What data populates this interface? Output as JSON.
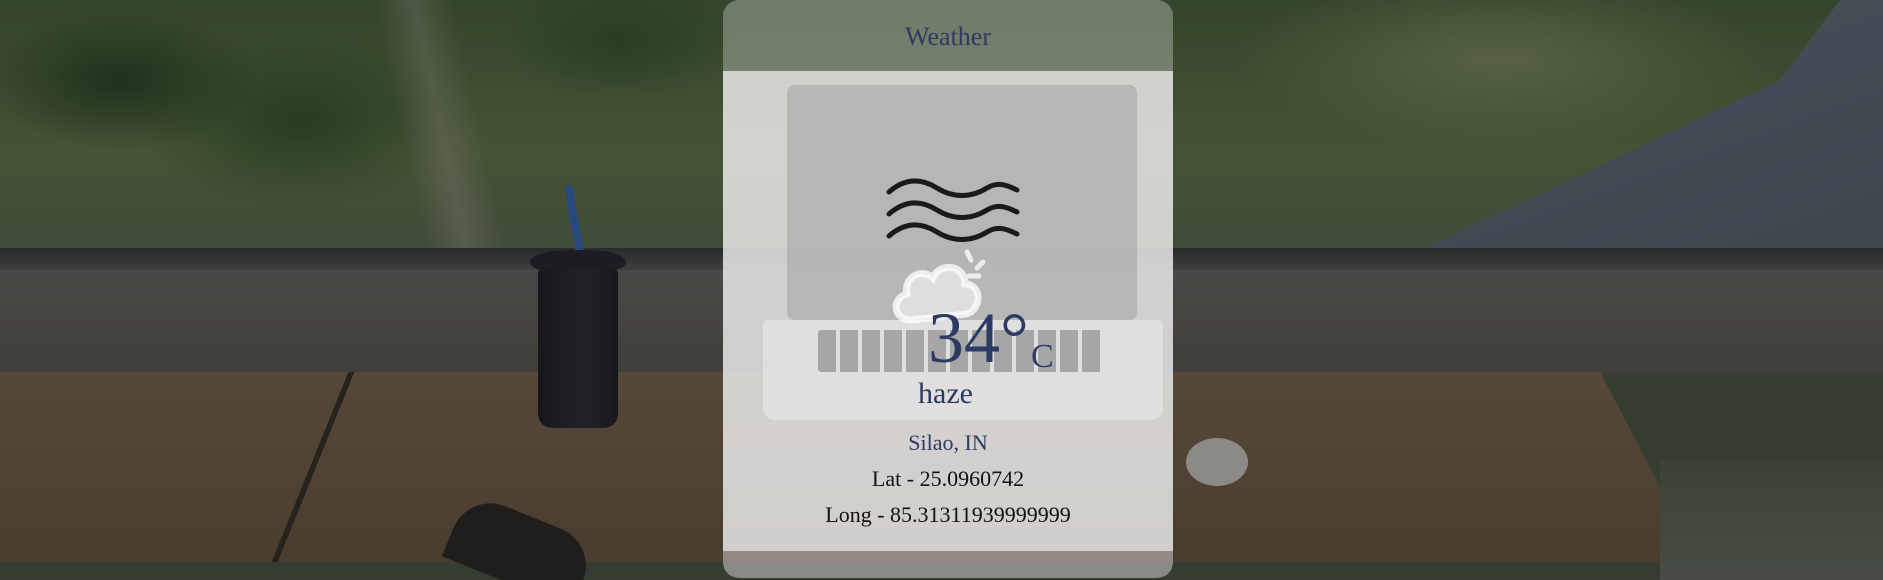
{
  "card": {
    "title": "Weather",
    "temperature": "34°",
    "unit": "C",
    "condition": "haze",
    "location": "Silao, IN",
    "latitude_text": "Lat - 25.0960742",
    "longitude_text": "Long - 85.31311939999999"
  },
  "icons": {
    "primary": "wind-icon",
    "secondary": "cloud-icon"
  },
  "colors": {
    "accent_text": "#2d3a63",
    "body_text": "#111111"
  }
}
